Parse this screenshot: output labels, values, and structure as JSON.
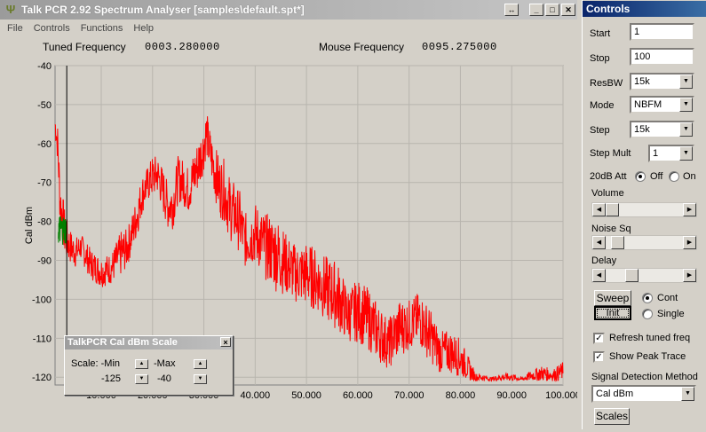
{
  "window": {
    "title": "Talk PCR 2.92 Spectrum Analyser [samples\\default.spt*]",
    "menu": [
      "File",
      "Controls",
      "Functions",
      "Help"
    ]
  },
  "readout": {
    "tuned_label": "Tuned Frequency",
    "tuned_value": "0003.280000",
    "mouse_label": "Mouse Frequency",
    "mouse_value": "0095.275000"
  },
  "chart_data": {
    "type": "line",
    "ylabel": "Cal dBm",
    "xlabel": "",
    "x_ticks": [
      "10.000",
      "20.000",
      "30.000",
      "40.000",
      "50.000",
      "60.000",
      "70.000",
      "80.000",
      "90.000",
      "100.000"
    ],
    "y_ticks": [
      "-40",
      "-50",
      "-60",
      "-70",
      "-80",
      "-90",
      "-100",
      "-110",
      "-120"
    ],
    "xlim": [
      1,
      100
    ],
    "ylim": [
      -122,
      -40
    ],
    "colors": {
      "trace": "#ff0000",
      "peak": "#008000",
      "marker": "#000000"
    },
    "tuned_marker_x": 3.28,
    "series": [
      {
        "x": [
          1,
          1.5,
          2,
          3,
          4,
          5,
          6,
          8,
          10,
          12,
          14,
          15,
          16,
          17,
          18,
          19,
          20,
          21,
          22,
          23,
          24,
          25,
          26,
          27,
          28,
          29,
          30,
          30.5,
          31,
          32,
          33,
          34,
          35,
          36,
          37,
          38,
          40,
          42,
          44,
          46,
          48,
          50,
          52,
          54,
          56,
          58,
          60,
          62,
          64,
          66,
          68,
          70,
          72,
          74,
          76,
          78,
          80,
          82,
          83,
          84,
          86,
          88,
          90,
          92,
          94,
          96,
          98,
          100
        ],
        "y": [
          -55,
          -60,
          -76,
          -85,
          -87,
          -88,
          -86,
          -90,
          -93,
          -92,
          -87,
          -88,
          -82,
          -78,
          -72,
          -70,
          -68,
          -67,
          -72,
          -76,
          -75,
          -68,
          -69,
          -72,
          -70,
          -65,
          -60,
          -56,
          -60,
          -66,
          -72,
          -73,
          -76,
          -78,
          -80,
          -84,
          -82,
          -86,
          -88,
          -90,
          -92,
          -93,
          -95,
          -98,
          -100,
          -104,
          -102,
          -106,
          -110,
          -113,
          -108,
          -107,
          -105,
          -110,
          -116,
          -113,
          -115,
          -119,
          -120,
          -121,
          -121,
          -121,
          -121,
          -121,
          -121,
          -121,
          -121,
          -121
        ],
        "hi": [
          -52,
          -55,
          -68,
          -78,
          -82,
          -84,
          -83,
          -87,
          -89,
          -88,
          -82,
          -82,
          -78,
          -73,
          -68,
          -66,
          -63,
          -63,
          -66,
          -70,
          -69,
          -63,
          -64,
          -66,
          -62,
          -58,
          -55,
          -51,
          -55,
          -60,
          -63,
          -64,
          -68,
          -70,
          -72,
          -78,
          -75,
          -78,
          -78,
          -83,
          -86,
          -85,
          -87,
          -89,
          -90,
          -97,
          -95,
          -97,
          -101,
          -105,
          -100,
          -100,
          -98,
          -102,
          -108,
          -108,
          -110,
          -116,
          -119,
          -119,
          -120,
          -119,
          -119,
          -120,
          -118,
          -117,
          -118,
          -116
        ],
        "lo": [
          -58,
          -65,
          -82,
          -90,
          -91,
          -92,
          -90,
          -95,
          -97,
          -96,
          -94,
          -92,
          -88,
          -84,
          -78,
          -75,
          -74,
          -73,
          -78,
          -82,
          -82,
          -75,
          -76,
          -78,
          -75,
          -72,
          -67,
          -63,
          -67,
          -73,
          -79,
          -80,
          -85,
          -86,
          -88,
          -92,
          -91,
          -95,
          -98,
          -99,
          -101,
          -102,
          -103,
          -106,
          -108,
          -111,
          -111,
          -113,
          -116,
          -118,
          -115,
          -113,
          -112,
          -116,
          -119,
          -119,
          -120,
          -121,
          -121,
          -121,
          -121,
          -121,
          -121,
          -121,
          -121,
          -121,
          -121,
          -121
        ]
      }
    ]
  },
  "scale_dialog": {
    "title": "TalkPCR Cal dBm Scale",
    "scale_label": "Scale: -Min",
    "max_label": "-Max",
    "min_value": "-125",
    "max_value": "-40",
    "close": "×"
  },
  "controls": {
    "title": "Controls",
    "start_label": "Start",
    "start_value": "1",
    "stop_label": "Stop",
    "stop_value": "100",
    "resbw_label": "ResBW",
    "resbw_value": "15k",
    "mode_label": "Mode",
    "mode_value": "NBFM",
    "step_label": "Step",
    "step_value": "15k",
    "stepmult_label": "Step Mult",
    "stepmult_value": "1",
    "att_label": "20dB Att",
    "att_off": "Off",
    "att_on": "On",
    "volume_label": "Volume",
    "noise_label": "Noise Sq",
    "delay_label": "Delay",
    "volume_level": 0.0,
    "noise_level": 0.08,
    "delay_level": 0.3,
    "sweep_label": "Sweep",
    "init_label": "Init",
    "cont_label": "Cont",
    "single_label": "Single",
    "refresh_label": "Refresh tuned freq",
    "peak_label": "Show Peak Trace",
    "detect_label": "Signal Detection Method",
    "detect_value": "Cal dBm",
    "scales_label": "Scales"
  }
}
